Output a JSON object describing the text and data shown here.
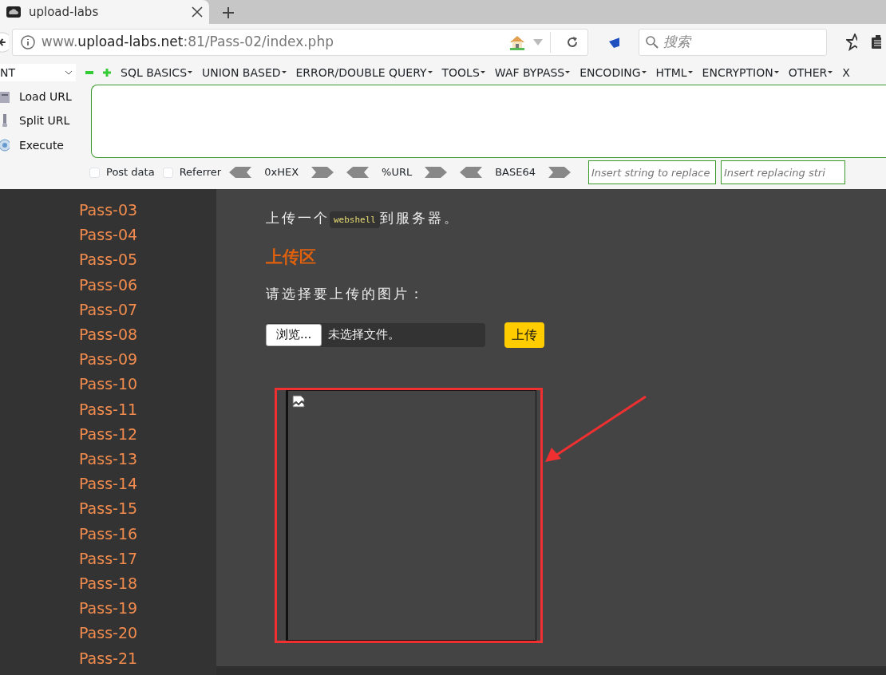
{
  "browser": {
    "tab_title": "upload-labs",
    "url": {
      "prefix": "www.",
      "domain": "upload-labs.net",
      "suffix": ":81/Pass-02/index.php"
    },
    "search": {
      "placeholder": "搜索"
    }
  },
  "hackbar": {
    "select_value": "NT",
    "menus": [
      "SQL BASICS",
      "UNION BASED",
      "ERROR/DOUBLE QUERY",
      "TOOLS",
      "WAF BYPASS",
      "ENCODING",
      "HTML",
      "ENCRYPTION",
      "OTHER",
      "X"
    ],
    "actions": [
      {
        "label": "Load URL",
        "kind": "load"
      },
      {
        "label": "Split URL",
        "kind": "split"
      },
      {
        "label": "Execute",
        "kind": "execute"
      }
    ],
    "options": [
      {
        "label": "Post data",
        "checked": false
      },
      {
        "label": "Referrer",
        "checked": false
      }
    ],
    "encoders": [
      "0xHEX",
      "%URL",
      "BASE64"
    ],
    "replace_fields": [
      {
        "placeholder": "Insert string to replace"
      },
      {
        "placeholder": "Insert replacing stri"
      }
    ]
  },
  "sidebar": {
    "items": [
      {
        "label": "Pass-03",
        "selected": false
      },
      {
        "label": "Pass-04",
        "selected": false
      },
      {
        "label": "Pass-05",
        "selected": false
      },
      {
        "label": "Pass-06",
        "selected": false
      },
      {
        "label": "Pass-07",
        "selected": false
      },
      {
        "label": "Pass-08",
        "selected": false
      },
      {
        "label": "Pass-09",
        "selected": false
      },
      {
        "label": "Pass-10",
        "selected": false
      },
      {
        "label": "Pass-11",
        "selected": false
      },
      {
        "label": "Pass-12",
        "selected": false
      },
      {
        "label": "Pass-13",
        "selected": false
      },
      {
        "label": "Pass-14",
        "selected": false
      },
      {
        "label": "Pass-15",
        "selected": false
      },
      {
        "label": "Pass-16",
        "selected": false
      },
      {
        "label": "Pass-17",
        "selected": false
      },
      {
        "label": "Pass-18",
        "selected": false
      },
      {
        "label": "Pass-19",
        "selected": false
      },
      {
        "label": "Pass-20",
        "selected": false
      },
      {
        "label": "Pass-21",
        "selected": false
      }
    ]
  },
  "content": {
    "intro": {
      "before": "上传一个",
      "code": "webshell",
      "after": "到服务器。"
    },
    "heading": "上传区",
    "prompt": "请选择要上传的图片：",
    "file_input": {
      "button": "浏览...",
      "status": "未选择文件。"
    },
    "submit": "上传",
    "preview": {
      "broken_image": true,
      "annotated": true
    }
  }
}
